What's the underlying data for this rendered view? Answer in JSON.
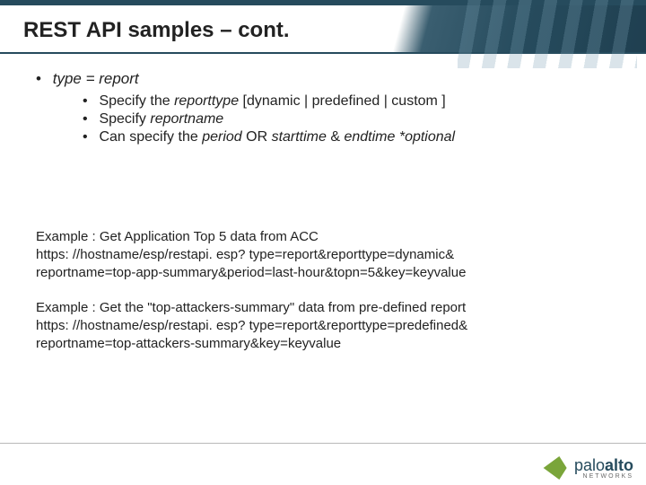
{
  "title": "REST API samples – cont.",
  "bullet": {
    "l1_bullet": "•",
    "l1_text": "type = report",
    "sub_bullet": "•",
    "sub1": {
      "pre": "Specify the ",
      "it1": "reporttype",
      "post": " [dynamic | predefined | custom ]"
    },
    "sub2": {
      "pre": "Specify ",
      "it1": "reportname"
    },
    "sub3": {
      "pre": "Can specify the ",
      "it1": "period",
      "mid": "  OR ",
      "it2": "starttime",
      "mid2": " & ",
      "it3": "endtime",
      "opt": " *optional"
    }
  },
  "examples": {
    "ex1": {
      "line1": "Example : Get  Application Top 5 data from ACC",
      "line2": "https: //hostname/esp/restapi. esp? type=report&reporttype=dynamic&",
      "line3": "reportname=top-app-summary&period=last-hour&topn=5&key=keyvalue"
    },
    "ex2": {
      "line1": "Example : Get the \"top-attackers-summary\" data from pre-defined report",
      "line2": "https: //hostname/esp/restapi. esp? type=report&reporttype=predefined&",
      "line3": "reportname=top-attackers-summary&key=keyvalue"
    }
  },
  "brand": {
    "light": "palo",
    "heavy": "alto",
    "sub": "NETWORKS"
  }
}
